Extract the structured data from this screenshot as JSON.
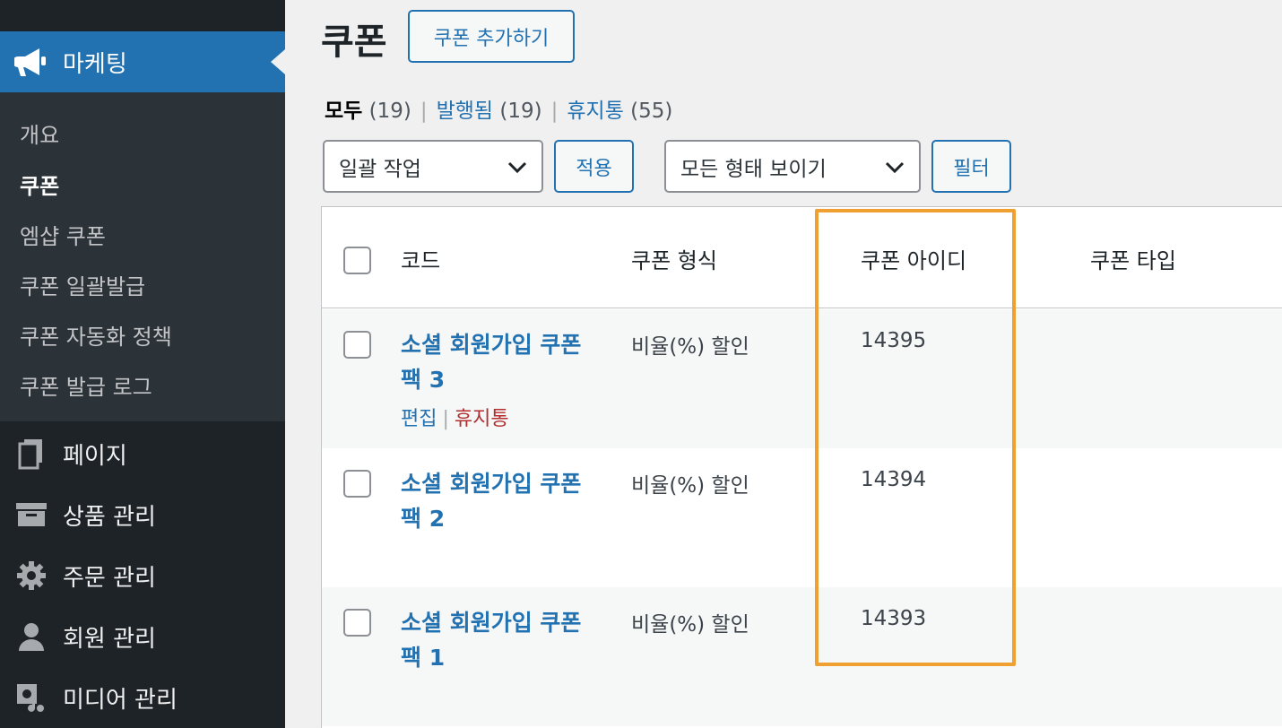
{
  "sidebar": {
    "active_menu": {
      "label": "마케팅",
      "icon": "megaphone-icon"
    },
    "submenu": [
      {
        "label": "개요",
        "current": false
      },
      {
        "label": "쿠폰",
        "current": true
      },
      {
        "label": "엠샵 쿠폰",
        "current": false
      },
      {
        "label": "쿠폰 일괄발급",
        "current": false
      },
      {
        "label": "쿠폰 자동화 정책",
        "current": false
      },
      {
        "label": "쿠폰 발급 로그",
        "current": false
      }
    ],
    "menu": [
      {
        "label": "페이지",
        "icon": "pages-icon"
      },
      {
        "label": "상품 관리",
        "icon": "archive-icon"
      },
      {
        "label": "주문 관리",
        "icon": "gear-icon"
      },
      {
        "label": "회원 관리",
        "icon": "user-icon"
      },
      {
        "label": "미디어 관리",
        "icon": "media-icon"
      }
    ]
  },
  "page": {
    "title": "쿠폰",
    "add_button": "쿠폰 추가하기"
  },
  "views": {
    "all_label": "모두",
    "all_count": "(19)",
    "published_label": "발행됨",
    "published_count": "(19)",
    "trash_label": "휴지통",
    "trash_count": "(55)"
  },
  "filters": {
    "bulk_action": "일괄 작업",
    "apply": "적용",
    "type_filter": "모든 형태 보이기",
    "filter": "필터"
  },
  "table": {
    "headers": {
      "code": "코드",
      "type": "쿠폰 형식",
      "id": "쿠폰 아이디",
      "kind": "쿠폰 타입"
    },
    "rows": [
      {
        "title_line1": "소셜 회원가입 쿠폰",
        "title_line2": "팩 3",
        "type": "비율(%) 할인",
        "id": "14395",
        "edit": "편집",
        "trash": "휴지통"
      },
      {
        "title_line1": "소셜 회원가입 쿠폰",
        "title_line2": "팩 2",
        "type": "비율(%) 할인",
        "id": "14394"
      },
      {
        "title_line1": "소셜 회원가입 쿠폰",
        "title_line2": "팩 1",
        "type": "비율(%) 할인",
        "id": "14393"
      }
    ]
  },
  "colors": {
    "accent": "#2271b1",
    "sidebar": "#1d2327",
    "highlight": "#f0a030",
    "trash": "#b32d2e"
  }
}
